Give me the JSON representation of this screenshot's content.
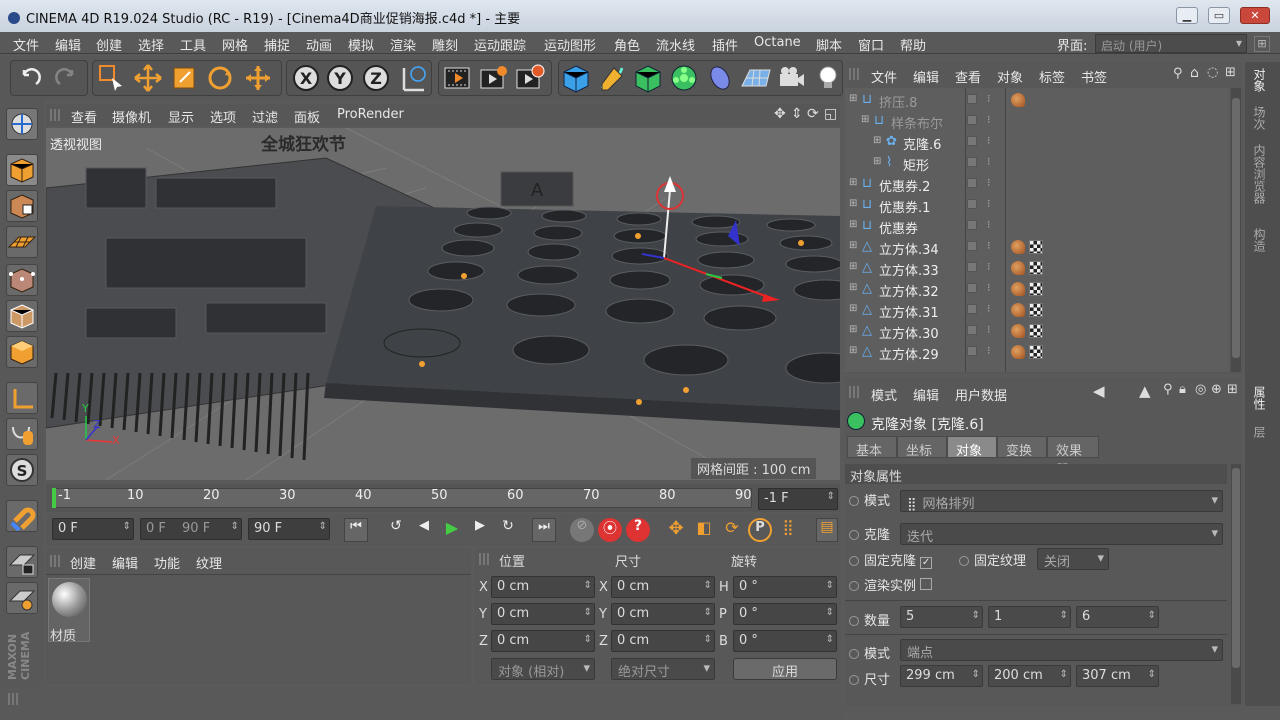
{
  "window": {
    "title": "CINEMA 4D R19.024 Studio (RC - R19) - [Cinema4D商业促销海报.c4d *] - 主要"
  },
  "menu": [
    "文件",
    "编辑",
    "创建",
    "选择",
    "工具",
    "网格",
    "捕捉",
    "动画",
    "模拟",
    "渲染",
    "雕刻",
    "运动跟踪",
    "运动图形",
    "角色",
    "流水线",
    "插件",
    "Octane",
    "脚本",
    "窗口",
    "帮助"
  ],
  "layout": {
    "label": "界面:",
    "value": "启动 (用户)"
  },
  "viewport": {
    "menu": [
      "查看",
      "摄像机",
      "显示",
      "选项",
      "过滤",
      "面板",
      "ProRender"
    ],
    "name": "透视视图",
    "grid_spacing": "网格间距 : 100 cm",
    "axis_x": "X",
    "axis_y": "Y",
    "axis_z": "Z",
    "scene_text": "全城狂欢节"
  },
  "timeline": {
    "ticks": [
      "-1",
      "10",
      "20",
      "30",
      "40",
      "50",
      "60",
      "70",
      "80",
      "90"
    ],
    "current_frame": "-1 F"
  },
  "transport": {
    "start": "0 F",
    "range_start": "0 F",
    "range_end": "90 F",
    "end": "90 F"
  },
  "materials": {
    "menu": [
      "创建",
      "编辑",
      "功能",
      "纹理"
    ],
    "item": "材质"
  },
  "coords": {
    "headers": {
      "position": "位置",
      "size": "尺寸",
      "rotation": "旋转"
    },
    "rows": [
      {
        "axis": "X",
        "pos": "0 cm",
        "saxis": "X",
        "size": "0 cm",
        "raxis": "H",
        "rot": "0 °"
      },
      {
        "axis": "Y",
        "pos": "0 cm",
        "saxis": "Y",
        "size": "0 cm",
        "raxis": "P",
        "rot": "0 °"
      },
      {
        "axis": "Z",
        "pos": "0 cm",
        "saxis": "Z",
        "size": "0 cm",
        "raxis": "B",
        "rot": "0 °"
      }
    ],
    "mode": "对象 (相对)",
    "size_mode": "绝对尺寸",
    "apply": "应用"
  },
  "objects": {
    "menu": [
      "文件",
      "编辑",
      "查看",
      "对象",
      "标签",
      "书签"
    ],
    "items": [
      {
        "name": "挤压.8",
        "indent": 0,
        "dim": true,
        "tags": "dot"
      },
      {
        "name": "样条布尔",
        "indent": 1,
        "dim": true,
        "tags": ""
      },
      {
        "name": "克隆.6",
        "indent": 2,
        "dim": false,
        "tags": ""
      },
      {
        "name": "矩形",
        "indent": 2,
        "dim": false,
        "tags": ""
      },
      {
        "name": "优惠券.2",
        "indent": 0,
        "dim": false,
        "tags": ""
      },
      {
        "name": "优惠券.1",
        "indent": 0,
        "dim": false,
        "tags": ""
      },
      {
        "name": "优惠券",
        "indent": 0,
        "dim": false,
        "tags": ""
      },
      {
        "name": "立方体.34",
        "indent": 0,
        "dim": false,
        "tags": "both"
      },
      {
        "name": "立方体.33",
        "indent": 0,
        "dim": false,
        "tags": "both"
      },
      {
        "name": "立方体.32",
        "indent": 0,
        "dim": false,
        "tags": "both"
      },
      {
        "name": "立方体.31",
        "indent": 0,
        "dim": false,
        "tags": "both"
      },
      {
        "name": "立方体.30",
        "indent": 0,
        "dim": false,
        "tags": "both"
      },
      {
        "name": "立方体.29",
        "indent": 0,
        "dim": false,
        "tags": "both"
      }
    ]
  },
  "attributes": {
    "menu": [
      "模式",
      "编辑",
      "用户数据"
    ],
    "title": "克隆对象 [克隆.6]",
    "tabs": [
      "基本",
      "坐标",
      "对象",
      "变换",
      "效果器"
    ],
    "active_tab": "对象",
    "section": "对象属性",
    "mode_label": "模式",
    "mode_value": "网格排列",
    "clone_label": "克隆",
    "clone_value": "迭代",
    "fix_clone": "固定克隆",
    "fix_texture": "固定纹理",
    "fix_texture_value": "关闭",
    "render_instance": "渲染实例",
    "count_label": "数量",
    "count": [
      "5",
      "1",
      "6"
    ],
    "mode2_label": "模式",
    "mode2_value": "端点",
    "size_label": "尺寸",
    "size": [
      "299 cm",
      "200 cm",
      "307 cm"
    ]
  },
  "right_tabs": [
    "对象",
    "场次",
    "内容浏览器",
    "构造",
    "属性",
    "层"
  ],
  "brand": "MAXON CINEMA"
}
